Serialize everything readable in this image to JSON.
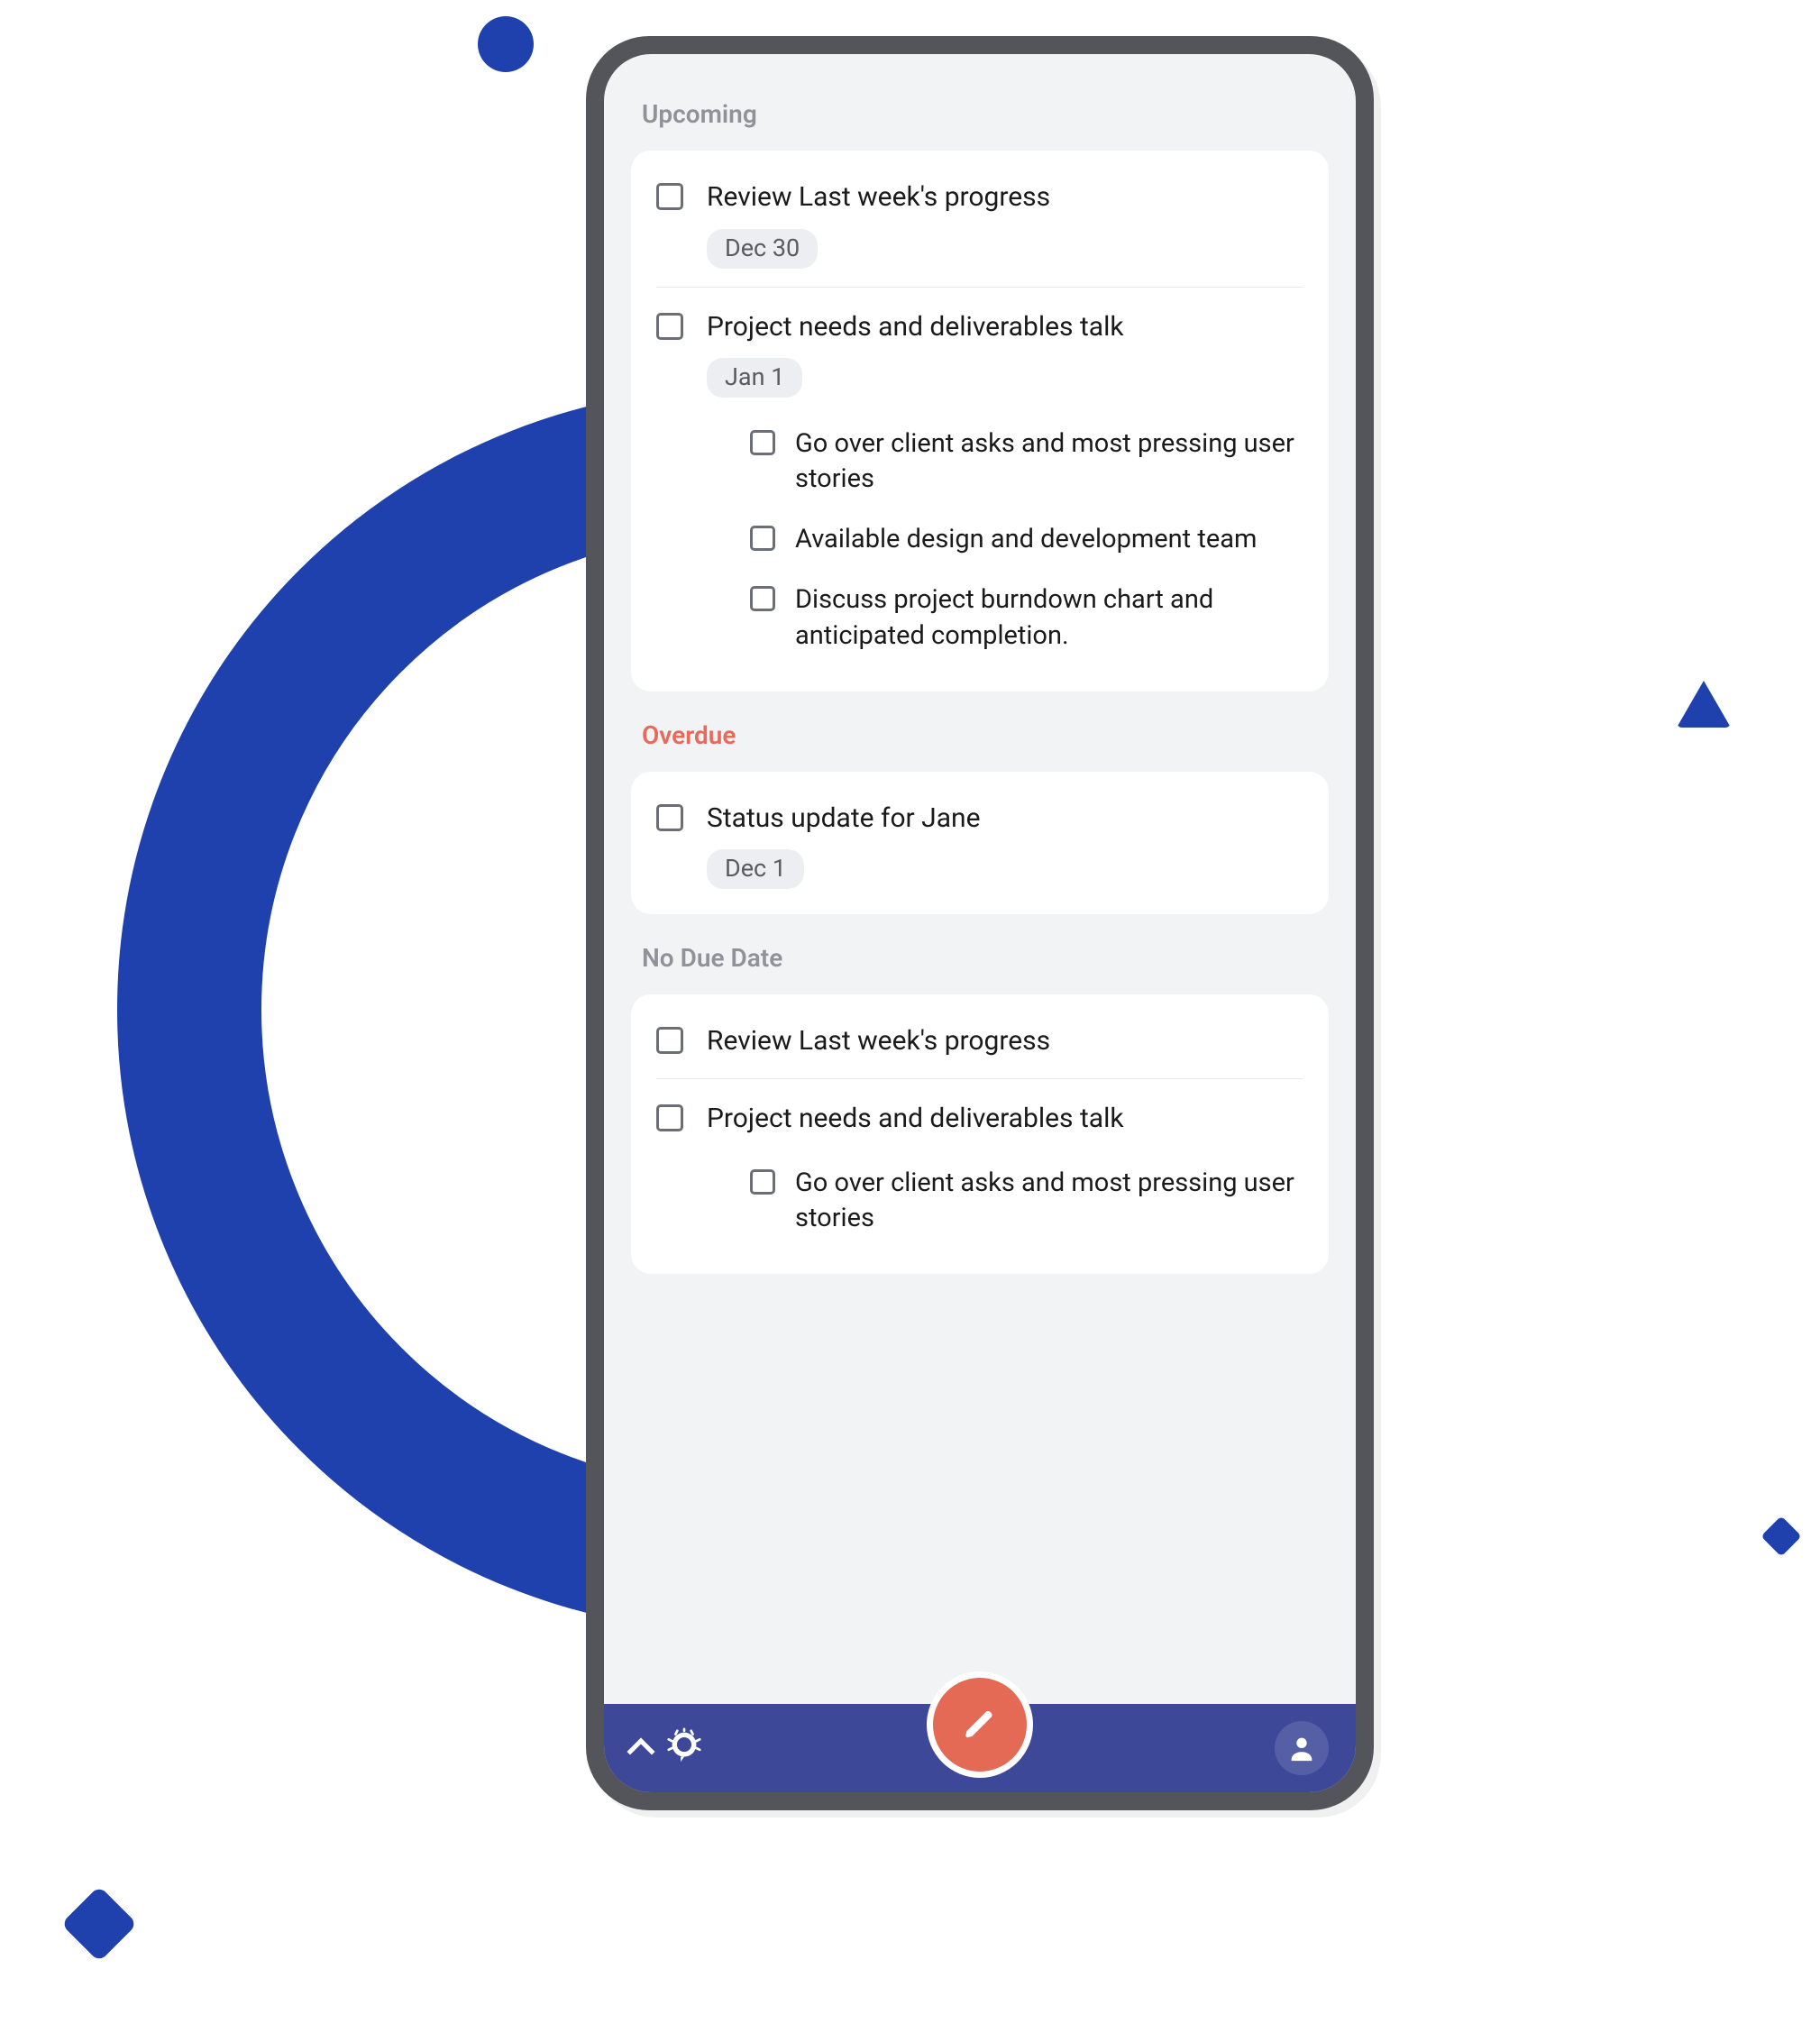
{
  "sections": {
    "upcoming": {
      "header": "Upcoming",
      "tasks": [
        {
          "title": "Review Last week's progress",
          "date": "Dec 30",
          "subtasks": []
        },
        {
          "title": "Project needs and deliverables talk",
          "date": "Jan 1",
          "subtasks": [
            {
              "title": "Go over client asks and most pressing user stories"
            },
            {
              "title": "Available design and development team"
            },
            {
              "title": "Discuss project burndown chart and anticipated completion."
            }
          ]
        }
      ]
    },
    "overdue": {
      "header": "Overdue",
      "tasks": [
        {
          "title": "Status update for Jane",
          "date": "Dec 1",
          "subtasks": []
        }
      ]
    },
    "nodue": {
      "header": "No Due Date",
      "tasks": [
        {
          "title": "Review Last week's progress",
          "date": null,
          "subtasks": []
        },
        {
          "title": "Project needs and deliverables talk",
          "date": null,
          "subtasks": [
            {
              "title": "Go over client asks and most pressing user stories"
            }
          ]
        }
      ]
    }
  }
}
